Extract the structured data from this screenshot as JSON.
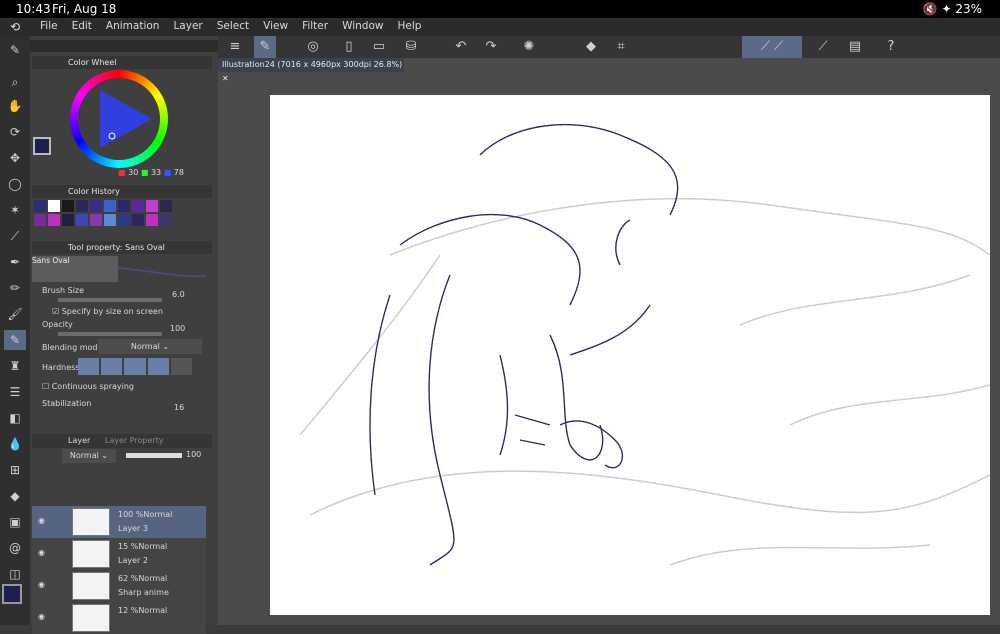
{
  "status_bar": {
    "time": "10:43",
    "date": "Fri, Aug 18",
    "battery": "23%"
  },
  "app_logo": "⟲",
  "menu": [
    "File",
    "Edit",
    "Animation",
    "Layer",
    "Select",
    "View",
    "Filter",
    "Window",
    "Help"
  ],
  "palettes": {
    "color_wheel": "Color Wheel",
    "color_history": "Color History",
    "tool_property": "Tool property: Sans Oval"
  },
  "color_values": {
    "r": "30",
    "g": "33",
    "b": "78"
  },
  "tool_property": {
    "brush_preview": "Sans Oval",
    "brush_size_label": "Brush Size",
    "brush_size_value": "6.0",
    "specify_by_size": "Specify by size on screen",
    "opacity_label": "Opacity",
    "opacity_value": "100",
    "blending_label": "Blending mode",
    "blending_value": "Normal",
    "hardness_label": "Hardness",
    "continuous_spraying": "Continuous spraying",
    "stabilization_label": "Stabilization",
    "stabilization_value": "16"
  },
  "layer_panel": {
    "tab_layer": "Layer",
    "tab_layer_property": "Layer Property",
    "blend_mode": "Normal",
    "opacity": "100"
  },
  "layers": [
    {
      "opacity_mode": "100 %Normal",
      "name": "Layer 3"
    },
    {
      "opacity_mode": "15 %Normal",
      "name": "Layer 2"
    },
    {
      "opacity_mode": "62 %Normal",
      "name": "Sharp anime"
    },
    {
      "opacity_mode": "12 %Normal",
      "name": ""
    }
  ],
  "document_tab": "Illustration24 (7016 x 4960px 300dpi 26.8%)",
  "colors": {
    "main_color": "#1e214e",
    "accent": "#5a6b86",
    "history": [
      "#2a2f70",
      "#ffffff",
      "#1a1a1a",
      "#2a2a5a",
      "#3a2a8a",
      "#3a62c8",
      "#2a2a6a",
      "#5a2a9a",
      "#c040d0",
      "#2a2a4a",
      "#7a2a9a",
      "#c030c0",
      "#202040",
      "#3a4ab0",
      "#8a3ab0",
      "#5a8ad0",
      "#2a3a8a",
      "#2a2a5a",
      "#c030c0",
      "#3a3a6a"
    ]
  }
}
